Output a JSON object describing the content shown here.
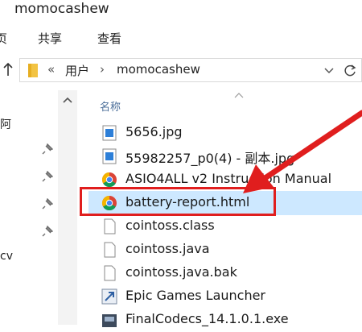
{
  "window": {
    "title": "momocashew"
  },
  "ribbon": {
    "tabs": [
      "页",
      "共享",
      "查看"
    ]
  },
  "address": {
    "overflow": "«",
    "crumbs": [
      "用户",
      "momocashew"
    ],
    "separator": "›"
  },
  "nav": {
    "fragments": [
      "阿",
      "cv"
    ]
  },
  "columns": {
    "name": "名称"
  },
  "files": [
    {
      "name": "5656.jpg",
      "icon": "image-file-icon"
    },
    {
      "name": "55982257_p0(4) - 副本.jpg",
      "icon": "image-file-icon"
    },
    {
      "name": "ASIO4ALL v2 Instruction Manual",
      "icon": "chrome-icon"
    },
    {
      "name": "battery-report.html",
      "icon": "chrome-icon",
      "selected": true
    },
    {
      "name": "cointoss.class",
      "icon": "blank-file-icon"
    },
    {
      "name": "cointoss.java",
      "icon": "blank-file-icon"
    },
    {
      "name": "cointoss.java.bak",
      "icon": "blank-file-icon"
    },
    {
      "name": "Epic Games Launcher",
      "icon": "shortcut-icon"
    },
    {
      "name": "FinalCodecs_14.1.0.1.exe",
      "icon": "installer-icon"
    }
  ],
  "colors": {
    "highlight": "#e01e1e",
    "selection": "#cde8ff",
    "header_text": "#4c6f9a"
  }
}
